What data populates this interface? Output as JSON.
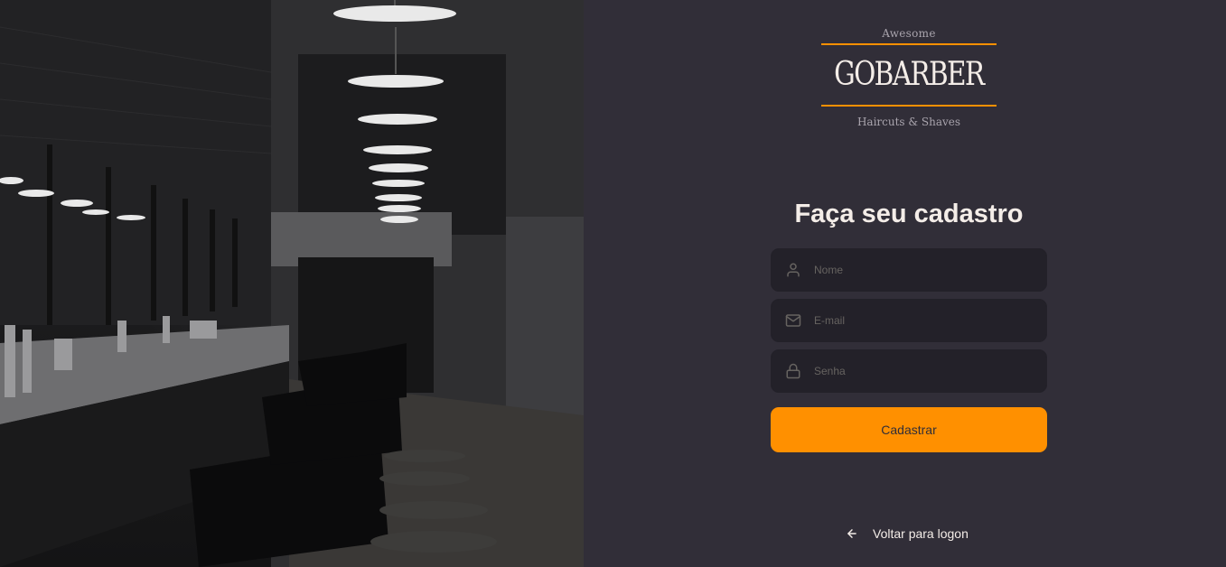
{
  "logo": {
    "top_text": "Awesome",
    "brand": "GOBARBER",
    "bottom_text": "Haircuts & Shaves"
  },
  "form": {
    "title": "Faça seu cadastro",
    "fields": [
      {
        "icon": "user-icon",
        "placeholder": "Nome",
        "value": ""
      },
      {
        "icon": "mail-icon",
        "placeholder": "E-mail",
        "value": ""
      },
      {
        "icon": "lock-icon",
        "placeholder": "Senha",
        "value": ""
      }
    ],
    "submit_label": "Cadastrar"
  },
  "back_link": {
    "icon": "arrow-left-icon",
    "label": "Voltar para logon"
  },
  "colors": {
    "background": "#312e38",
    "input_background": "#232129",
    "accent": "#ff9000",
    "text": "#f4ede8",
    "placeholder": "#666360"
  }
}
